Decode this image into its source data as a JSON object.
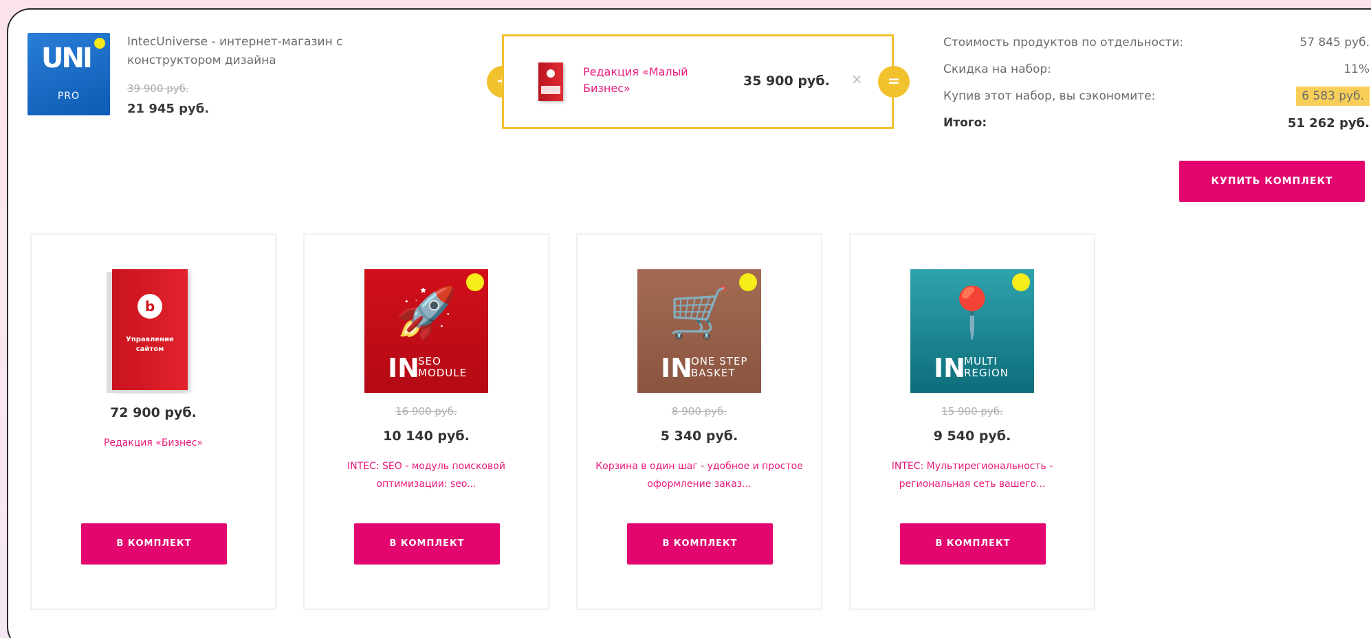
{
  "main_product": {
    "logo_text": "UNI",
    "logo_sub": "PRO",
    "title": "IntecUniverse - интернет-магазин с конструктором дизайна",
    "old_price": "39 900 руб.",
    "price": "21 945 руб."
  },
  "bundle": {
    "plus": "+",
    "equals": "=",
    "item_name": "Редакция «Малый Бизнес»",
    "item_price": "35 900 руб.",
    "remove": "×"
  },
  "summary": {
    "rows": [
      {
        "label": "Стоимость продуктов по отдельности:",
        "value": "57 845 руб."
      },
      {
        "label": "Скидка на набор:",
        "value": "11%"
      },
      {
        "label": "Купив этот набор, вы сэкономите:",
        "value": "6 583 руб."
      },
      {
        "label": "Итого:",
        "value": "51 262 руб."
      }
    ],
    "buy_button": "купить комплект"
  },
  "cards": [
    {
      "box_letter": "b",
      "box_label": "Управление сайтом",
      "price": "72 900 руб.",
      "name": "Редакция «Бизнес»",
      "button": "в комплект"
    },
    {
      "brand": "IN",
      "caption": "SEO MODULE",
      "icon": "rocket-icon",
      "old_price": "16 900 руб.",
      "price": "10 140 руб.",
      "name": "INTEC: SEO - модуль поисковой оптимизации: seo...",
      "button": "в комплект"
    },
    {
      "brand": "IN",
      "caption": "ONE STEP BASKET",
      "icon": "basket-icon",
      "old_price": "8 900 руб.",
      "price": "5 340 руб.",
      "name": "Корзина в один шаг - удобное и простое оформление заказ...",
      "button": "в комплект"
    },
    {
      "brand": "IN",
      "caption": "MULTI REGION",
      "icon": "map-pin-icon",
      "old_price": "15 900 руб.",
      "price": "9 540 руб.",
      "name": "INTEC: Мультирегиональность - региональная сеть вашего...",
      "button": "в комплект"
    }
  ],
  "colors": {
    "accent": "#e2066e",
    "highlight": "#f2c12e",
    "link": "#e8197a"
  }
}
